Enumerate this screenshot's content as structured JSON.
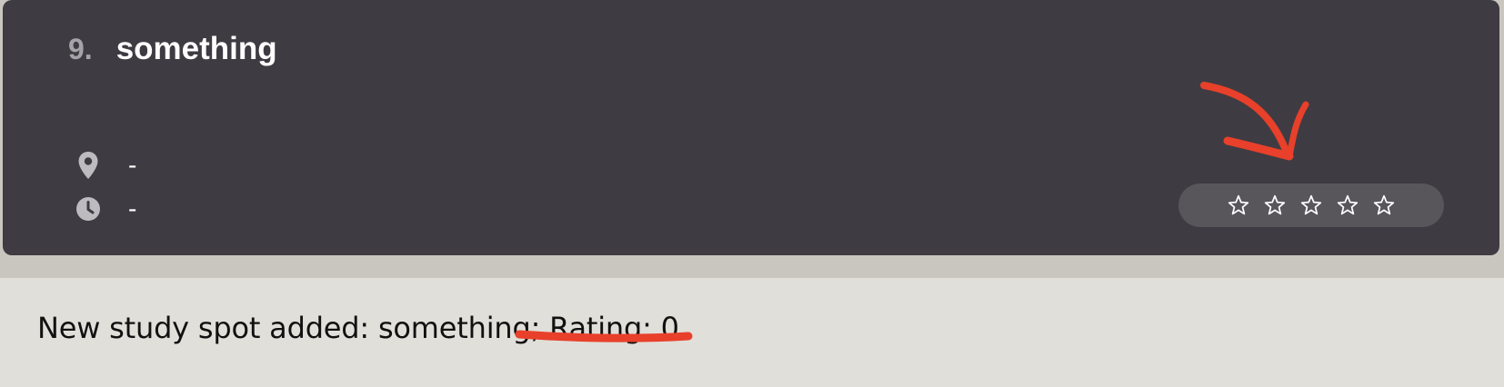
{
  "card": {
    "index": "9.",
    "title": "something",
    "location": {
      "icon": "location-pin-icon",
      "value": "-"
    },
    "time": {
      "icon": "clock-icon",
      "value": "-"
    },
    "rating": {
      "max": 5,
      "value": 0,
      "star_icon": "star-outline-icon"
    }
  },
  "message": {
    "prefix": "New study spot added: something; ",
    "rating_part": "Rating: 0"
  },
  "colors": {
    "card_background": "#3f3b42",
    "rating_pill": "#58555b",
    "message_background": "#e1dfd9",
    "annotation": "#e8402a"
  },
  "annotations": {
    "arrow": "annotation-arrow",
    "underline": "annotation-underline"
  }
}
